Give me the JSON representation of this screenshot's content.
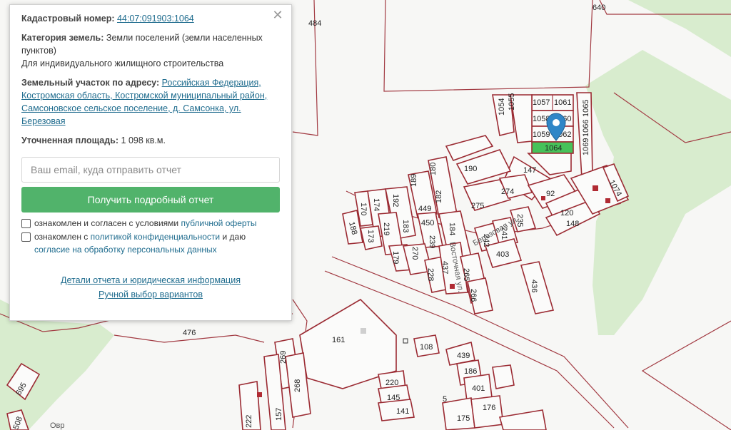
{
  "popup": {
    "cadastral_label": "Кадастровый номер:",
    "cadastral_number": "44:07:091903:1064",
    "category_label": "Категория земель:",
    "category_value": "Земли поселений (земли населенных пунктов)",
    "usage": "Для индивидуального жилищного строительства",
    "address_label": "Земельный участок по адресу:",
    "address_value": "Российская Федерация, Костромская область, Костромской муниципальный район, Самсоновское сельское поселение, д. Самсонка, ул. Березовая",
    "area_label": "Уточненная площадь:",
    "area_value": "1 098 кв.м.",
    "email_placeholder": "Ваш email, куда отправить отчет",
    "report_button": "Получить подробный отчет",
    "offer_prefix": "ознакомлен и согласен с условиями",
    "offer_link": "публичной оферты",
    "privacy_prefix": "ознакомлен с",
    "privacy_link": "политикой конфиденциальности",
    "privacy_suffix": "и даю",
    "privacy_consent": "согласие на обработку персональных данных",
    "details_link": "Детали отчета и юридическая информация",
    "manual_link": "Ручной выбор вариантов",
    "close_symbol": "✕"
  },
  "map": {
    "plot_labels": [
      "640",
      "484",
      "1057",
      "1061",
      "1055",
      "1054",
      "1058",
      "1060",
      "1059",
      "1062",
      "1064",
      "1065",
      "1066",
      "1069",
      "190",
      "147",
      "180",
      "189",
      "449",
      "182",
      "275",
      "274",
      "92",
      "1074",
      "120",
      "148",
      "192",
      "174",
      "170",
      "188",
      "219",
      "183",
      "173",
      "450",
      "184",
      "239",
      "242",
      "241",
      "403",
      "235",
      "270",
      "179",
      "228",
      "437",
      "265",
      "266",
      "436",
      "161",
      "108",
      "439",
      "186",
      "401",
      "220",
      "145",
      "141",
      "175",
      "176",
      "476",
      "269",
      "268",
      "157",
      "222",
      "695",
      "508",
      "5"
    ],
    "street_labels": [
      "Березовая ул.",
      "Восточная ул.",
      "Овр"
    ],
    "selected_plot": "1064",
    "colors": {
      "boundary": "#9b2b33",
      "selected": "#46c25a",
      "forest": "#d8ecce",
      "pin": "#2f86c7"
    }
  }
}
